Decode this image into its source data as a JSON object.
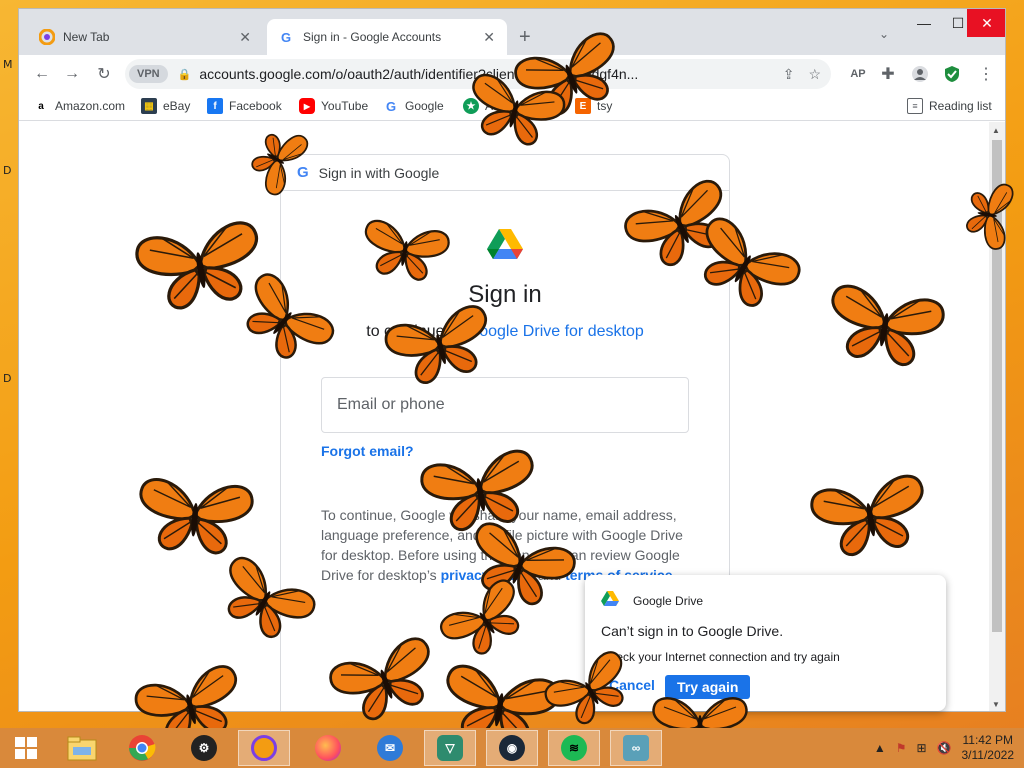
{
  "desktop": {
    "letters": [
      "M",
      "D",
      "D"
    ]
  },
  "tabs": [
    {
      "title": "New Tab",
      "active": false
    },
    {
      "title": "Sign in - Google Accounts",
      "active": true
    }
  ],
  "toolbar": {
    "vpn_label": "VPN",
    "url": "accounts.google.com/o/oauth2/auth/identifier?client...6bn6qk8qdgf4n..."
  },
  "bookmarks": [
    {
      "label": "Amazon.com",
      "icon": "amazon-icon"
    },
    {
      "label": "eBay",
      "icon": "ebay-icon"
    },
    {
      "label": "Facebook",
      "icon": "facebook-icon"
    },
    {
      "label": "YouTube",
      "icon": "youtube-icon"
    },
    {
      "label": "Google",
      "icon": "google-icon"
    },
    {
      "label": "Ad",
      "icon": "ad-icon"
    },
    {
      "label": "tsy",
      "icon": "etsy-icon"
    }
  ],
  "reading_list": "Reading list",
  "signin": {
    "header": "Sign in with Google",
    "title": "Sign in",
    "subtitle_prefix": "to continue to ",
    "subtitle_link": "Google Drive for desktop",
    "email_placeholder": "Email or phone",
    "forgot": "Forgot email?",
    "info_1": "To continue, Google will share your name, email address, language preference, and profile picture with Google Drive for desktop. Before using this app, you can review Google Drive for desktop’s ",
    "info_privacy": "privacy policy",
    "info_and": " and ",
    "info_terms": "terms of service",
    "info_end": "."
  },
  "toast": {
    "app": "Google Drive",
    "title": "Can’t sign in to Google Drive.",
    "message": "Check your Internet connection and try again",
    "cancel": "Cancel",
    "retry": "Try again"
  },
  "taskbar": {
    "apps": [
      "start-icon",
      "file-explorer-icon",
      "chrome-icon",
      "security-app-icon",
      "vpn-browser-icon",
      "firefox-icon",
      "thunderbird-icon",
      "proton-vpn-icon",
      "steam-icon",
      "spotify-icon",
      "network-app-icon"
    ],
    "time": "11:42 PM",
    "date": "3/11/2022"
  },
  "colors": {
    "accent": "#1a73e8",
    "desktop": "#f39c12",
    "butterfly": "#f07d12"
  }
}
